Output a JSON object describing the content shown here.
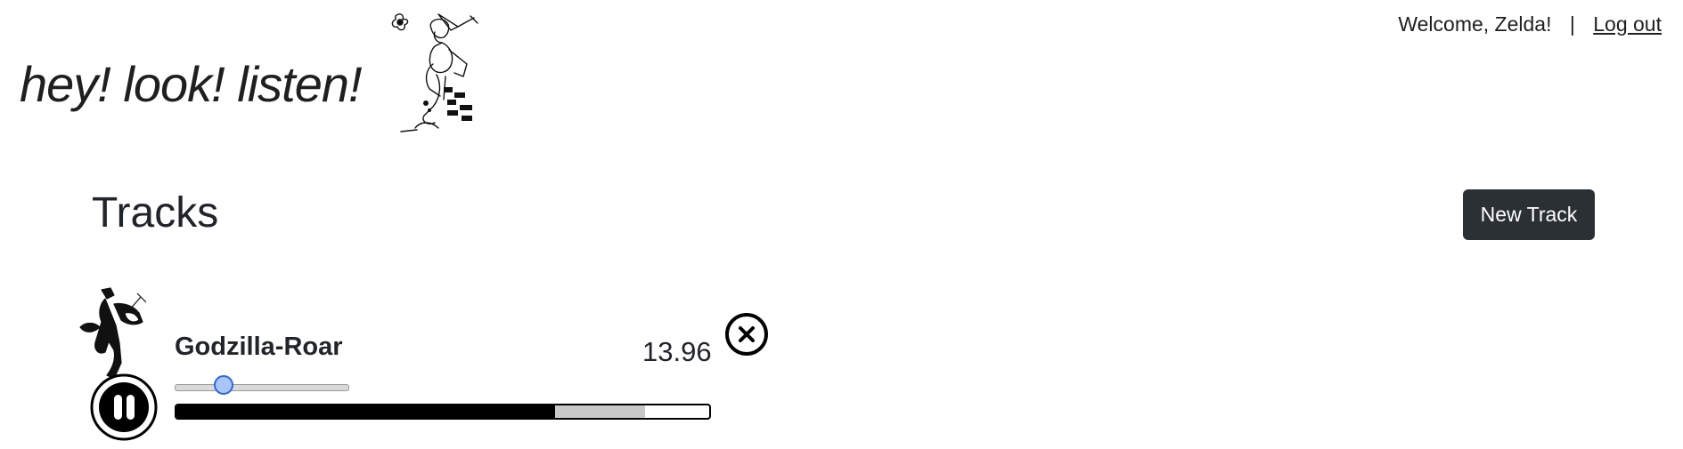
{
  "header": {
    "brand": "hey! look! listen!",
    "welcome": "Welcome, Zelda!",
    "separator": "|",
    "logout": "Log out"
  },
  "main": {
    "title": "Tracks",
    "new_track_label": "New Track"
  },
  "tracks": [
    {
      "name": "Godzilla-Roar",
      "value": "13.96",
      "volume": 0.28,
      "progress": {
        "played": 0.71,
        "buffered": 0.88
      }
    }
  ],
  "icons": {
    "play": "pause-icon",
    "remove": "close-icon"
  },
  "colors": {
    "button_bg": "#2b3035",
    "slider_thumb": "#2c68d8"
  }
}
